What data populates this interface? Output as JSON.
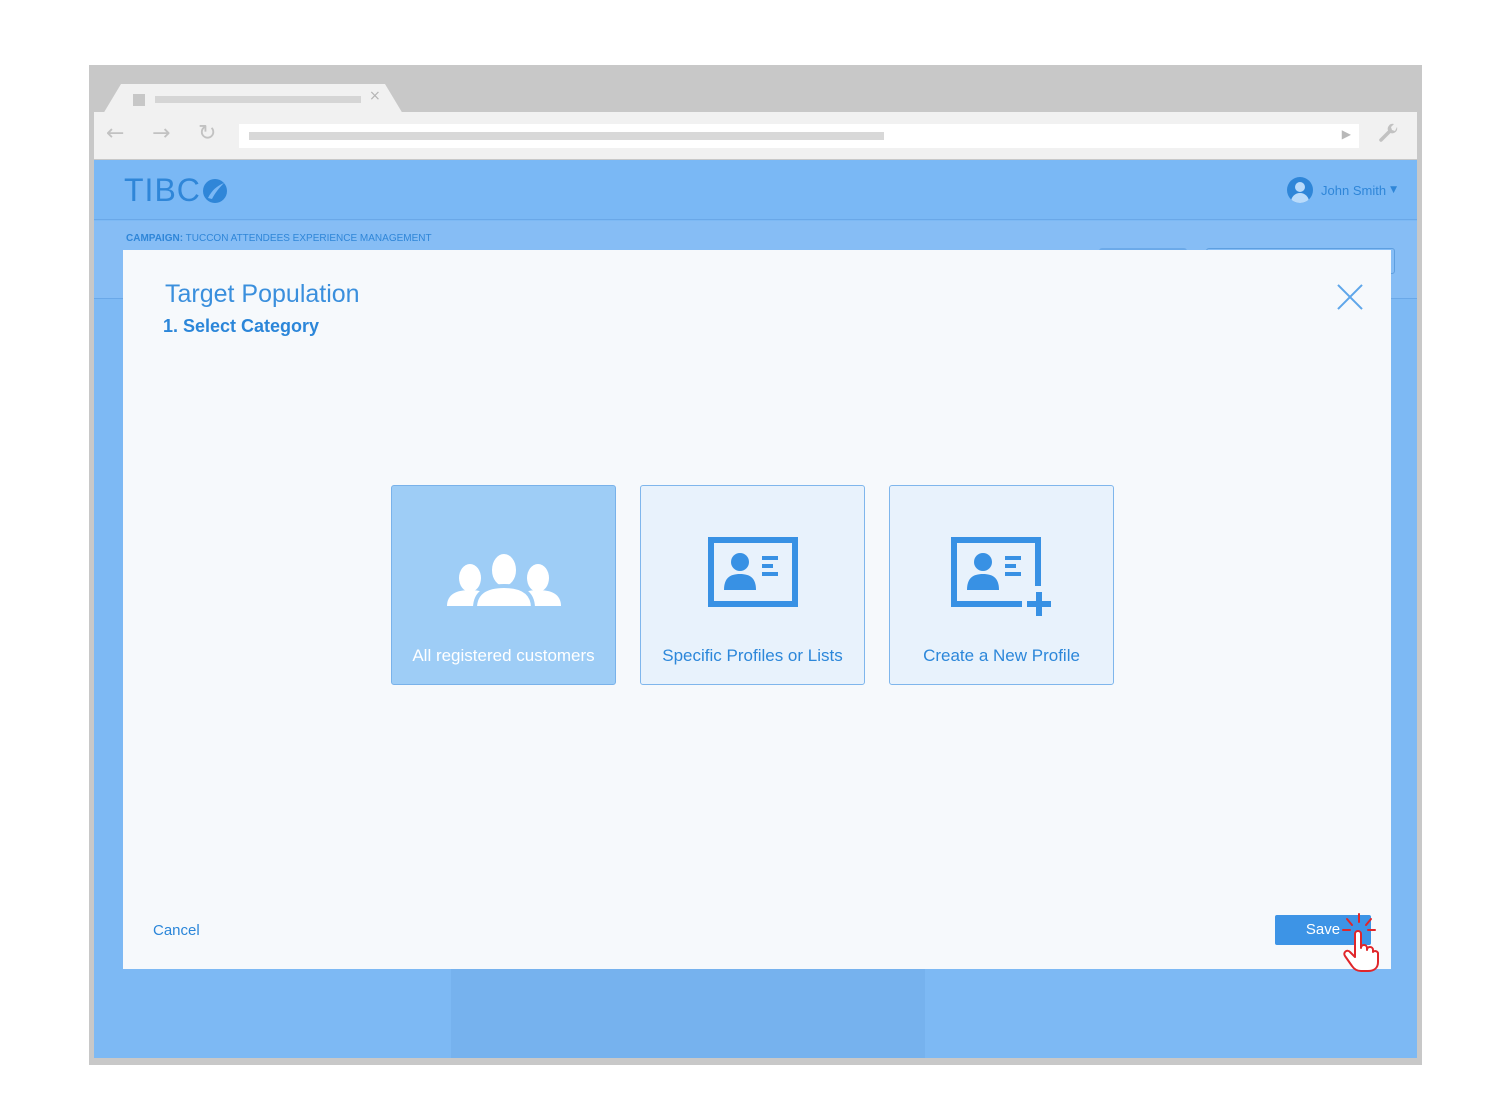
{
  "app": {
    "logo_text": "TIBC",
    "user_name": "John Smith",
    "campaign_label": "CAMPAIGN:",
    "campaign_name": "TUCCON ATTENDEES EXPERIENCE MANAGEMENT"
  },
  "modal": {
    "title": "Target Population",
    "step": "1. Select Category",
    "cards": [
      {
        "label": "All registered customers",
        "icon": "group-icon",
        "selected": true
      },
      {
        "label": "Specific Profiles or Lists",
        "icon": "profile-card-icon",
        "selected": false
      },
      {
        "label": "Create a New Profile",
        "icon": "add-profile-icon",
        "selected": false
      }
    ],
    "cancel_label": "Cancel",
    "save_label": "Save"
  },
  "colors": {
    "accent": "#2f86d8",
    "background": "#7db9f4",
    "modal_bg": "#f6f9fc",
    "selected_card": "#9ecdf6",
    "save_button": "#3d94e6"
  }
}
